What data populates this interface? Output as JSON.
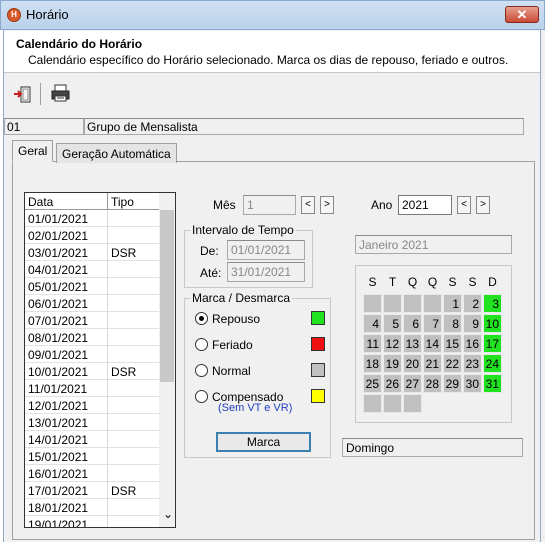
{
  "window": {
    "title": "Horário",
    "close_label": "✕"
  },
  "header": {
    "title": "Calendário do Horário",
    "subtitle": "Calendário específico do Horário selecionado. Marca os dias de repouso, feriado e outros."
  },
  "group": {
    "code": "01",
    "name": "Grupo de Mensalista"
  },
  "tabs": [
    {
      "label": "Geral"
    },
    {
      "label": "Geração Automática"
    }
  ],
  "list": {
    "headers": {
      "data": "Data",
      "tipo": "Tipo"
    },
    "rows": [
      {
        "data": "01/01/2021",
        "tipo": ""
      },
      {
        "data": "02/01/2021",
        "tipo": ""
      },
      {
        "data": "03/01/2021",
        "tipo": "DSR"
      },
      {
        "data": "04/01/2021",
        "tipo": ""
      },
      {
        "data": "05/01/2021",
        "tipo": ""
      },
      {
        "data": "06/01/2021",
        "tipo": ""
      },
      {
        "data": "07/01/2021",
        "tipo": ""
      },
      {
        "data": "08/01/2021",
        "tipo": ""
      },
      {
        "data": "09/01/2021",
        "tipo": ""
      },
      {
        "data": "10/01/2021",
        "tipo": "DSR"
      },
      {
        "data": "11/01/2021",
        "tipo": ""
      },
      {
        "data": "12/01/2021",
        "tipo": ""
      },
      {
        "data": "13/01/2021",
        "tipo": ""
      },
      {
        "data": "14/01/2021",
        "tipo": ""
      },
      {
        "data": "15/01/2021",
        "tipo": ""
      },
      {
        "data": "16/01/2021",
        "tipo": ""
      },
      {
        "data": "17/01/2021",
        "tipo": "DSR"
      },
      {
        "data": "18/01/2021",
        "tipo": ""
      },
      {
        "data": "19/01/2021",
        "tipo": ""
      }
    ],
    "scroll_down": "⌄"
  },
  "mes": {
    "label": "Mês",
    "value": "1",
    "prev": "<",
    "next": ">"
  },
  "ano": {
    "label": "Ano",
    "value": "2021",
    "prev": "<",
    "next": ">"
  },
  "intervalo": {
    "title": "Intervalo de Tempo",
    "de_label": "De:",
    "de_value": "01/01/2021",
    "ate_label": "Até:",
    "ate_value": "31/01/2021"
  },
  "month_display": "Janeiro 2021",
  "marca": {
    "title": "Marca / Desmarca",
    "options": [
      {
        "label": "Repouso",
        "selected": true,
        "color": "#21e221"
      },
      {
        "label": "Feriado",
        "selected": false,
        "color": "#ee1111"
      },
      {
        "label": "Normal",
        "selected": false,
        "color": "#c0c0c0"
      },
      {
        "label": "Compensado",
        "selected": false,
        "color": "#ffff00"
      }
    ],
    "compensado_note": "(Sem VT e VR)",
    "button_label": "Marca"
  },
  "calendar": {
    "weekdays": [
      "S",
      "T",
      "Q",
      "Q",
      "S",
      "S",
      "D"
    ],
    "days": [
      "",
      "",
      "",
      "",
      "1",
      "2",
      "3",
      "4",
      "5",
      "6",
      "7",
      "8",
      "9",
      "10",
      "11",
      "12",
      "13",
      "14",
      "15",
      "16",
      "17",
      "18",
      "19",
      "20",
      "21",
      "22",
      "23",
      "24",
      "25",
      "26",
      "27",
      "28",
      "29",
      "30",
      "31",
      "",
      "",
      ""
    ],
    "green_days": [
      "3",
      "10",
      "17",
      "24",
      "31"
    ]
  },
  "day_status": "Domingo",
  "colors": {
    "accent": "#3c7fb1",
    "green": "#21e221",
    "red": "#ee1111",
    "gray": "#c0c0c0",
    "yellow": "#ffff00"
  }
}
